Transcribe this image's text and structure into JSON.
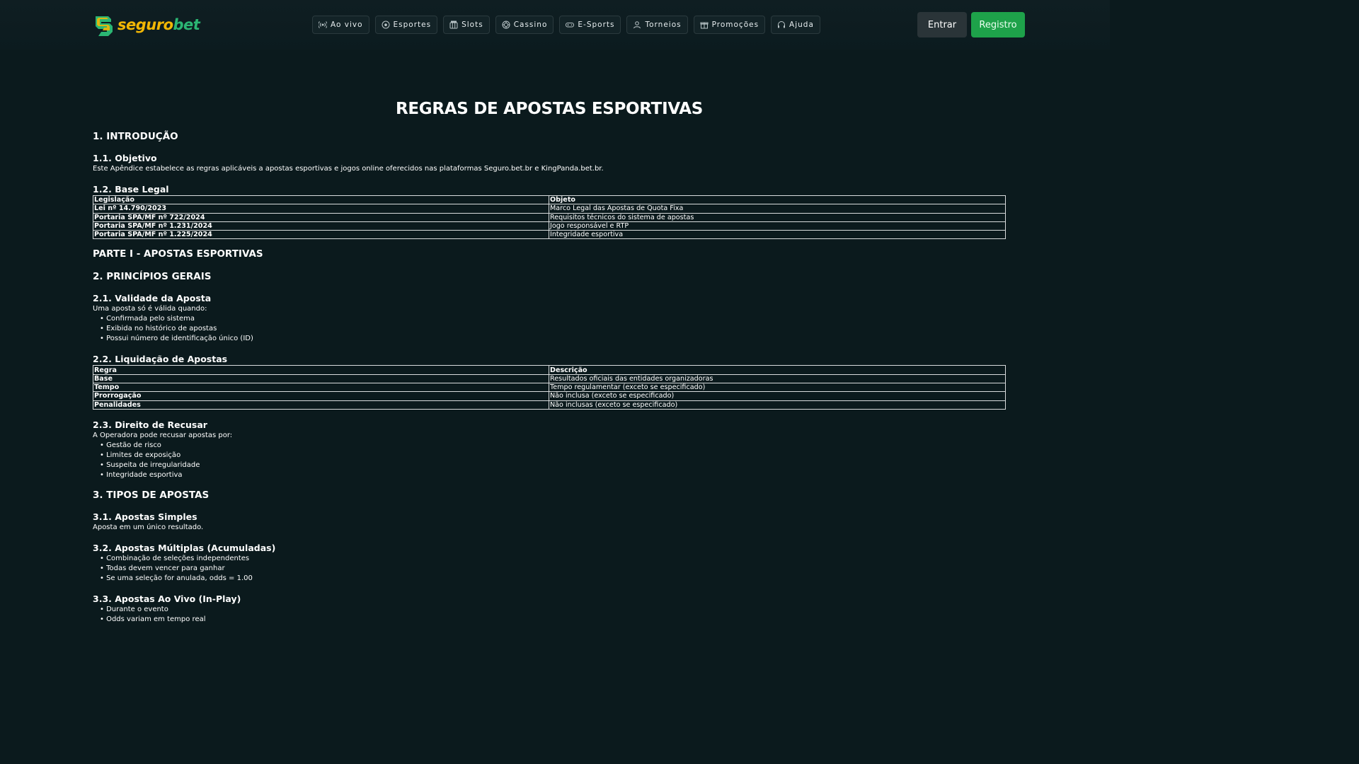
{
  "header": {
    "logo_part1": "seguro",
    "logo_part2": "bet",
    "nav": [
      {
        "label": "Ao vivo",
        "icon": "live-icon"
      },
      {
        "label": "Esportes",
        "icon": "soccer-ball-icon"
      },
      {
        "label": "Slots",
        "icon": "slots-icon"
      },
      {
        "label": "Cassino",
        "icon": "chip-icon"
      },
      {
        "label": "E-Sports",
        "icon": "gamepad-icon"
      },
      {
        "label": "Torneios",
        "icon": "user-icon"
      },
      {
        "label": "Promoções",
        "icon": "gift-icon"
      },
      {
        "label": "Ajuda",
        "icon": "headset-icon"
      }
    ],
    "login_label": "Entrar",
    "register_label": "Registro"
  },
  "colors": {
    "background": "#0b1a1d",
    "brand_yellow": "#f2b705",
    "brand_green": "#2bb673",
    "register_button": "#1ea24a"
  },
  "doc": {
    "title": "REGRAS DE APOSTAS ESPORTIVAS",
    "s1": "1. INTRODUÇÃO",
    "s11": "1.1. Objetivo",
    "s11_text": "Este Apêndice estabelece as regras aplicáveis a apostas esportivas e jogos online oferecidos nas plataformas Seguro.bet.br e KingPanda.bet.br.",
    "s12": "1.2. Base Legal",
    "t1_head": [
      "Legislação",
      "Objeto"
    ],
    "t1_rows": [
      [
        "Lei nº 14.790/2023",
        "Marco Legal das Apostas de Quota Fixa"
      ],
      [
        "Portaria SPA/MF nº 722/2024",
        "Requisitos técnicos do sistema de apostas"
      ],
      [
        "Portaria SPA/MF nº 1.231/2024",
        "Jogo responsável e RTP"
      ],
      [
        "Portaria SPA/MF nº 1.225/2024",
        "Integridade esportiva"
      ]
    ],
    "part1": "PARTE I - APOSTAS ESPORTIVAS",
    "s2": "2. PRINCÍPIOS GERAIS",
    "s21": "2.1. Validade da Aposta",
    "s21_text": "Uma aposta só é válida quando:",
    "s21_items": [
      "Confirmada pelo sistema",
      "Exibida no histórico de apostas",
      "Possui número de identificação único (ID)"
    ],
    "s22": "2.2. Liquidação de Apostas",
    "t2_head": [
      "Regra",
      "Descrição"
    ],
    "t2_rows": [
      [
        "Base",
        "Resultados oficiais das entidades organizadoras"
      ],
      [
        "Tempo",
        "Tempo regulamentar (exceto se especificado)"
      ],
      [
        "Prorrogação",
        "Não inclusa (exceto se especificado)"
      ],
      [
        "Penalidades",
        "Não inclusas (exceto se especificado)"
      ]
    ],
    "s23": "2.3. Direito de Recusar",
    "s23_text": "A Operadora pode recusar apostas por:",
    "s23_items": [
      "Gestão de risco",
      "Limites de exposição",
      "Suspeita de irregularidade",
      "Integridade esportiva"
    ],
    "s3": "3. TIPOS DE APOSTAS",
    "s31": "3.1. Apostas Simples",
    "s31_text": "Aposta em um único resultado.",
    "s32": "3.2. Apostas Múltiplas (Acumuladas)",
    "s32_items": [
      "Combinação de seleções independentes",
      "Todas devem vencer para ganhar",
      "Se uma seleção for anulada, odds = 1.00"
    ],
    "s33": "3.3. Apostas Ao Vivo (In-Play)",
    "s33_items": [
      "Durante o evento",
      "Odds variam em tempo real"
    ]
  }
}
